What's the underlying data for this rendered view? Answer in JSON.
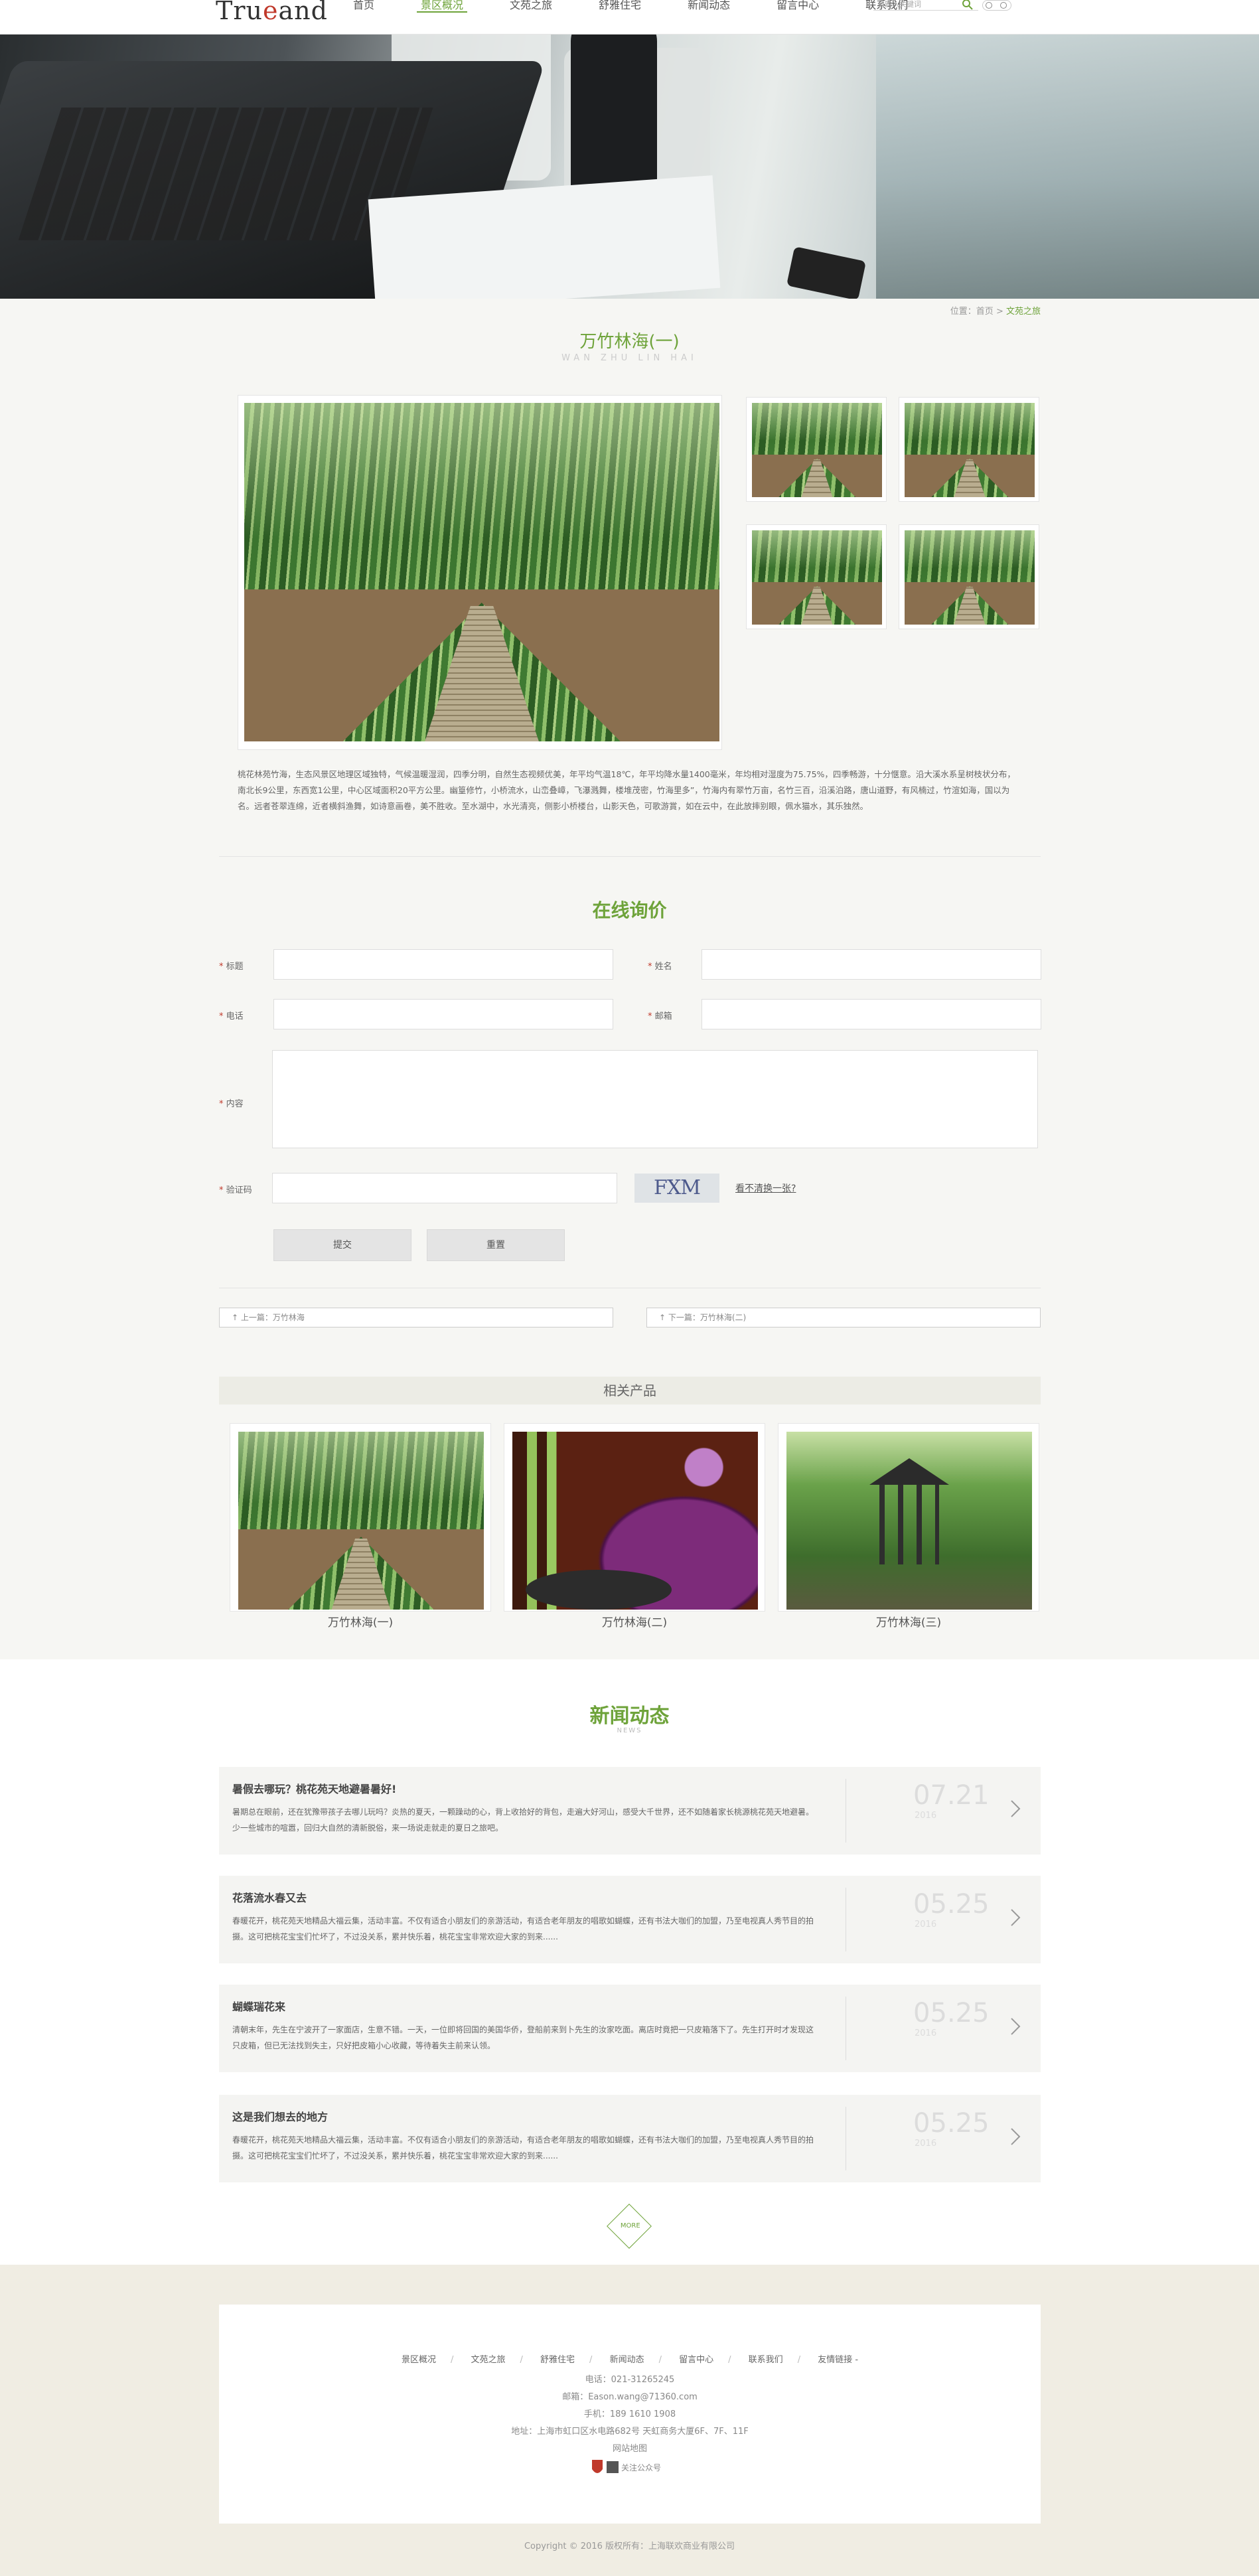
{
  "header": {
    "logo": "TrueLand",
    "nav": [
      "首页",
      "景区概况",
      "文苑之旅",
      "舒雅住宅",
      "新闻动态",
      "留言中心",
      "联系我们"
    ],
    "active_index": 1,
    "search_placeholder": "请输入关键词"
  },
  "breadcrumb": {
    "prefix": "位置：",
    "home": "首页",
    "sep": " > ",
    "current": "文苑之旅"
  },
  "product": {
    "title": "万竹林海(一)",
    "subtitle": "WAN ZHU LIN HAI",
    "intro": "桃花林苑竹海，生态风景区地理区域独特，气候温暖湿润，四季分明，自然生态视频优美，年平均气温18℃，年平均降水量1400毫米，年均相对湿度为75.75%，四季畅游，十分惬意。沿大溪水系呈树枝状分布，南北长9公里，东西宽1公里，中心区域面积20平方公里。幽篁修竹，小桥流水，山峦叠嶂，飞瀑溅舞，楼堆茂密，竹海里多”，竹海内有翠竹万亩，名竹三百，沿溪泊路，唐山道野，有风楠过，竹渲如海，国以为名。远者苍翠连绵，近者横斜渔舞，如诗意画卷，美不胜收。至水湖中，水光清亮，侧影小桥楼台，山影天色，可歌游賞，如在云中，在此放摔别眼，佩水猫水，其乐独然。"
  },
  "form": {
    "title": "在线询价",
    "labels": {
      "subject": "标题",
      "name": "姓名",
      "phone": "电话",
      "email": "邮箱",
      "content": "内容",
      "captcha": "验证码"
    },
    "captcha_text": "FXM",
    "captcha_link": "看不清换一张?",
    "submit": "提交",
    "reset": "重置"
  },
  "pager": {
    "prev": "上一篇：万竹林海",
    "next": "下一篇：万竹林海(二)"
  },
  "related": {
    "title": "相关产品",
    "items": [
      "万竹林海(一)",
      "万竹林海(二)",
      "万竹林海(三)"
    ]
  },
  "news": {
    "title": "新闻动态",
    "subtitle": "NEWS",
    "items": [
      {
        "title": "暑假去哪玩？桃花苑天地避暑暑好!",
        "desc": "暑期总在眼前，还在犹豫带孩子去哪儿玩吗？炎热的夏天，一颗躁动的心，背上收拾好的背包，走遍大好河山，感受大千世界，还不如随着家长桃源桃花苑天地避暑。少一些城市的喧嚣，回归大自然的清新脱俗，来一场说走就走的夏日之旅吧。",
        "date": "07.21",
        "year": "2016"
      },
      {
        "title": "花落流水春又去",
        "desc": "春暖花开，桃花苑天地精品大福云集，活动丰富。不仅有适合小朋友们的亲游活动，有适合老年朋友的唱歌如蝴蝶，还有书法大咖们的加盟，乃至电视真人秀节目的拍摄。这可把桃花宝宝们忙坏了，不过没关系，累并快乐着，桃花宝宝非常欢迎大家的到来......",
        "date": "05.25",
        "year": "2016"
      },
      {
        "title": "蝴蝶瑞花来",
        "desc": "清朝末年，先生在宁波开了一家面店，生意不错。一天，一位即将回国的美国华侨，登船前来到卜先生的汝家吃面。离店时竟把一只皮箱落下了。先生打开时才发现这只皮箱，但已无法找到失主，只好把皮箱小心收藏，等待着失主前来认领。",
        "date": "05.25",
        "year": "2016"
      },
      {
        "title": "这是我们想去的地方",
        "desc": "春暖花开，桃花苑天地精品大福云集，活动丰富。不仅有适合小朋友们的亲游活动，有适合老年朋友的唱歌如蝴蝶，还有书法大咖们的加盟，乃至电视真人秀节目的拍摄。这可把桃花宝宝们忙坏了，不过没关系，累并快乐着，桃花宝宝非常欢迎大家的到来......",
        "date": "05.25",
        "year": "2016"
      }
    ],
    "more": "MORE"
  },
  "footer": {
    "nav": [
      "景区概况",
      "文苑之旅",
      "舒雅住宅",
      "新闻动态",
      "留言中心",
      "联系我们",
      "友情链接 -"
    ],
    "phone": "电话：021-31265245",
    "email": "邮箱：Eason.wang@71360.com",
    "mobile": "手机：189 1610 1908",
    "address": "地址：上海市虹口区水电路682号 天虹商务大厦6F、7F、11F",
    "sitemap": "网站地图",
    "wechat": "关注公众号",
    "copyright": "Copyright © 2016 版权所有：上海联欢商业有限公司"
  },
  "colors": {
    "accent": "#6ea33a",
    "required": "#c0392b"
  }
}
